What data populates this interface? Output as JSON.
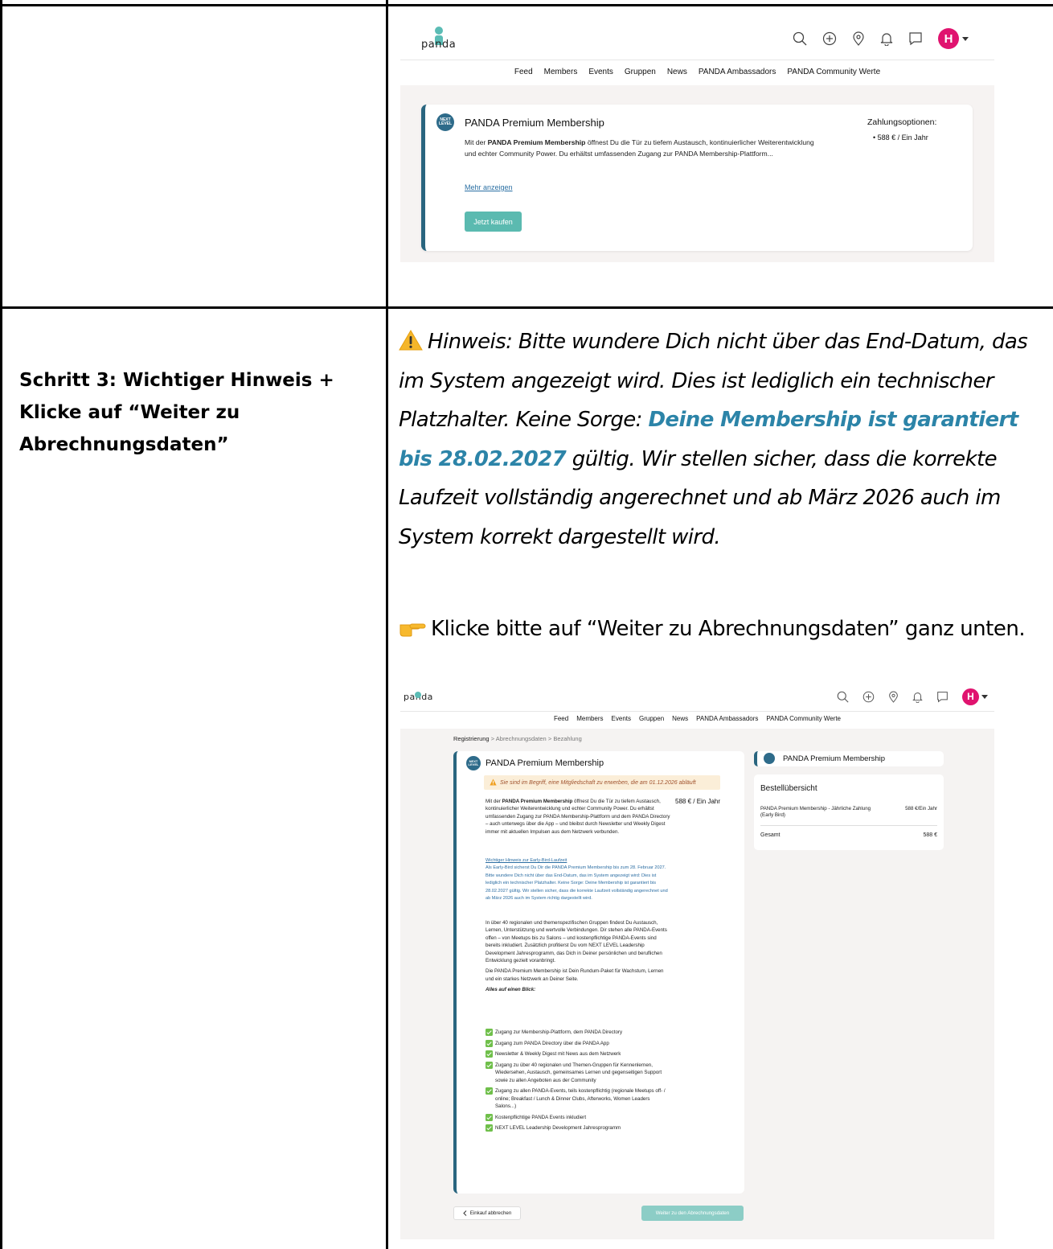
{
  "row1": {
    "screenshot": {
      "logo_text": "panda",
      "avatar_letter": "H",
      "nav": [
        "Feed",
        "Members",
        "Events",
        "Gruppen",
        "News",
        "PANDA Ambassadors",
        "PANDA Community Werte"
      ],
      "card": {
        "badge": "NEXT LEVEL",
        "title": "PANDA Premium Membership",
        "desc_bold": "PANDA Premium Membership",
        "desc_pre": "Mit der ",
        "desc_post": " öffnest Du die Tür zu tiefem Austausch, kontinuierlicher Weiterentwicklung und echter Community Power. Du erhältst umfassenden Zugang zur PANDA Membership-Plattform...",
        "more_link": "Mehr anzeigen",
        "buy_button": "Jetzt kaufen",
        "payment_heading": "Zahlungsoptionen:",
        "payment_option": "• 588 € / Ein Jahr"
      }
    }
  },
  "row2": {
    "step_heading": "Schritt 3:  Wichtiger Hinweis + Klicke auf “Weiter zu Abrechnungsdaten”",
    "hint_pre": "Hinweis: Bitte wundere Dich nicht über das End-Datum, das im System angezeigt wird. Dies ist lediglich ein technischer Platzhalter. Keine Sorge: ",
    "hint_strong": "Deine Membership ist garantiert bis 28.02.2027",
    "hint_post": " gültig. Wir stellen sicher, dass die korrekte Laufzeit vollständig angerechnet und ab März 2026 auch im System korrekt dargestellt wird.",
    "click_text": "Klicke bitte auf “Weiter zu Abrechnungsdaten” ganz unten.",
    "screenshot": {
      "logo_text": "panda",
      "avatar_letter": "H",
      "nav": [
        "Feed",
        "Members",
        "Events",
        "Gruppen",
        "News",
        "PANDA Ambassadors",
        "PANDA Community Werte"
      ],
      "breadcrumb": {
        "step1": "Registrierung",
        "sep": ">",
        "step2": "Abrechnungsdaten",
        "step3": "Bezahlung"
      },
      "main": {
        "badge": "NEXT LEVEL",
        "title": "PANDA Premium Membership",
        "alert": "Sie sind im Begriff, eine Mitgliedschaft zu erwerben, die am 01.12.2026 abläuft",
        "price": "588 € / Ein Jahr",
        "intro_pre": "Mit der ",
        "intro_bold": "PANDA Premium Membership",
        "intro_post": " öffnest Du die Tür zu tiefem Austausch, kontinuierlicher Weiterentwicklung und echter Community Power. Du erhältst umfassenden Zugang zur PANDA Membership-Plattform und dem PANDA Directory – auch unterwegs über die App – und bleibst durch Newsletter und Weekly Digest immer mit aktuellen Impulsen aus dem Netzwerk verbunden.",
        "earlybird_link": "Wichtiger Hinweis zur Early-Bird-Laufzeit",
        "earlybird_text": "Als Early-Bird sicherst Du Dir die PANDA Premium Membership bis zum 28. Februar 2027. Bitte wundere Dich nicht über das End-Datum, das im System angezeigt wird: Dies ist lediglich ein technischer Platzhalter. Keine Sorge: Deine Membership ist garantiert bis 28.02.2027 gültig. Wir stellen sicher, dass die korrekte Laufzeit vollständig angerechnet und ab März 2026 auch im System richtig dargestellt wird.",
        "para2": "In über 40 regionalen und themenspezifischen Gruppen findest Du Austausch, Lernen, Unterstützung und wertvolle Verbindungen. Dir stehen alle PANDA-Events offen – von Meetups bis zu Salons – und kostenpflichtige PANDA-Events sind bereits inkludiert. Zusätzlich profitierst Du vom NEXT LEVEL Leadership Development Jahresprogramm, das Dich in Deiner persönlichen und beruflichen Entwicklung gezielt voranbringt.",
        "para3": "Die PANDA Premium Membership ist Dein Rundum-Paket für Wachstum, Lernen und ein starkes Netzwerk an Deiner Seite.",
        "overview_heading": "Alles auf einen Blick:",
        "benefits": [
          "Zugang zur Membership-Plattform, dem PANDA Directory",
          "Zugang zum PANDA Directory über die PANDA App",
          "Newsletter & Weekly Digest mit News aus dem Netzwerk",
          "Zugang zu über 40 regionalen und Themen-Gruppen für Kennenlernen, Wiedersehen, Austausch, gemeinsames Lernen und gegenseitigen Support sowie zu allen Angeboten aus der Community",
          "Zugang zu allen PANDA-Events, teils kostenpflichtig (regionale Meetups off- / online; Breakfast / Lunch & Dinner Clubs, Afterworks, Women Leaders Salons...)",
          "Kostenpflichtige PANDA Events inkludiert",
          "NEXT LEVEL Leadership Development Jahresprogramm"
        ]
      },
      "side": {
        "title": "PANDA Premium Membership",
        "summary_heading": "Bestellübersicht",
        "line_label": "PANDA Premium Membership - Jährliche Zahlung (Early Bird)",
        "line_value": "588 €/Ein Jahr",
        "total_label": "Gesamt",
        "total_value": "588 €"
      },
      "cancel_button": "Einkauf abbrechen",
      "next_button": "Weiter zu den Abrechnungsdaten"
    }
  },
  "colors": {
    "accent": "#5bbab0",
    "brand_dark": "#29657f",
    "highlight_blue": "#2c84a8",
    "avatar": "#e0136f"
  }
}
